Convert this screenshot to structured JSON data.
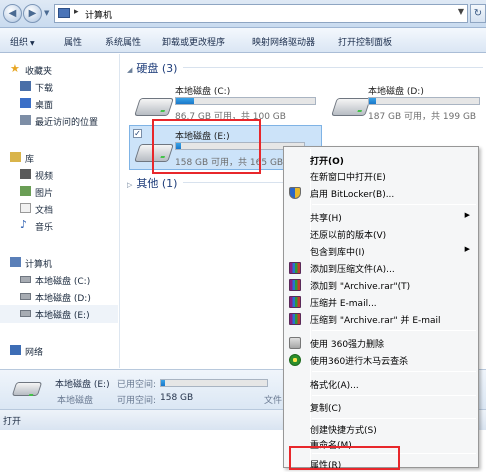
{
  "address": {
    "path": "计算机",
    "back_glyph": "◀",
    "fwd_glyph": "▶",
    "refresh_glyph": "↻"
  },
  "toolbar": {
    "organize": "组织",
    "properties": "属性",
    "system_properties": "系统属性",
    "uninstall": "卸载或更改程序",
    "map_drive": "映射网络驱动器",
    "control_panel": "打开控制面板"
  },
  "sidebar": {
    "favorites": "收藏夹",
    "downloads": "下载",
    "desktop": "桌面",
    "recent": "最近访问的位置",
    "libraries": "库",
    "videos": "视频",
    "pictures": "图片",
    "documents": "文档",
    "music": "音乐",
    "computer": "计算机",
    "drive_c": "本地磁盘 (C:)",
    "drive_d": "本地磁盘 (D:)",
    "drive_e": "本地磁盘 (E:)",
    "network": "网络"
  },
  "content": {
    "hard_disks_header": "硬盘 (3)",
    "other_header": "其他 (1)",
    "drives": [
      {
        "name": "本地磁盘 (C:)",
        "info": "86.7 GB 可用，共 100 GB",
        "used_fraction": 0.13
      },
      {
        "name": "本地磁盘 (D:)",
        "info": "187 GB 可用，共 199 GB",
        "used_fraction": 0.06
      },
      {
        "name": "本地磁盘 (E:)",
        "info": "158 GB 可用，共 165 GB",
        "used_fraction": 0.04
      }
    ]
  },
  "details": {
    "name": "本地磁盘 (E:)",
    "used_label": "已用空间:",
    "type": "本地磁盘",
    "free_label": "可用空间:",
    "free_value": "158 GB",
    "fs_partial": "文件"
  },
  "status": {
    "text": "打开"
  },
  "context_menu": {
    "open": "打开(O)",
    "open_new_window": "在新窗口中打开(E)",
    "bitlocker": "启用 BitLocker(B)...",
    "share": "共享(H)",
    "restore": "还原以前的版本(V)",
    "include_library": "包含到库中(I)",
    "add_archive": "添加到压缩文件(A)...",
    "add_archive_rar": "添加到 \"Archive.rar\"(T)",
    "compress_email": "压缩并 E-mail...",
    "compress_rar_email": "压缩到 \"Archive.rar\" 并 E-mail",
    "delete_360": "使用 360强力删除",
    "scan_360": "使用360进行木马云查杀",
    "format": "格式化(A)...",
    "copy": "复制(C)",
    "create_shortcut": "创建快捷方式(S)",
    "rename": "重命名(M)",
    "properties": "属性(R)"
  },
  "colors": {
    "highlight_red": "#e8272b",
    "drive_bar": "#1a77c9",
    "selection": "#cce3f9"
  }
}
